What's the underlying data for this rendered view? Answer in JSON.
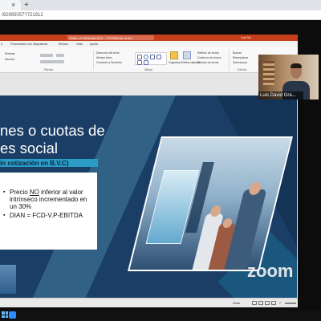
{
  "browser": {
    "tab_close": "×",
    "new_tab": "+",
    "url": "/92995057?721912"
  },
  "ppt": {
    "title": "TEMA 2-2 PERUANA 2023 - 7 POTENCIAL NUEV...",
    "user": "Luis Sol",
    "menu": [
      "s",
      "Presentación con diapositivas",
      "Revisar",
      "Vista",
      "Ayuda"
    ],
    "ribbon": {
      "left_items": [
        "Eliminar",
        "Sección"
      ],
      "font_items": [
        "Dirección del texto",
        "Alinear texto",
        "Convertir a SmartArt"
      ],
      "arrange": "Organizar",
      "quick_styles": "Estilos rápidos",
      "shape_fill": "Relleno de forma",
      "shape_outline": "Contorno de forma",
      "shape_effects": "Efectos de forma",
      "find": "Buscar",
      "replace": "Reemplazar",
      "select": "Seleccionar",
      "groups": [
        "Párrafo",
        "Dibujo",
        "Edición"
      ]
    },
    "status": {
      "notes": "Notas",
      "zoom": "7"
    }
  },
  "slide": {
    "title": "nes o cuotas de\nes social",
    "subtitle": "in cotización en B.V.C)",
    "bullets": [
      {
        "pre": "Precio ",
        "u": "NO",
        "post": " inferior al valor intrínseco incrementado en un 30%"
      },
      {
        "pre": "DIAN = FCD-V.P-EBITDA",
        "u": "",
        "post": ""
      }
    ]
  },
  "zoom": {
    "logo": "zoom"
  },
  "participant": {
    "name": "Luis David Gra..."
  }
}
